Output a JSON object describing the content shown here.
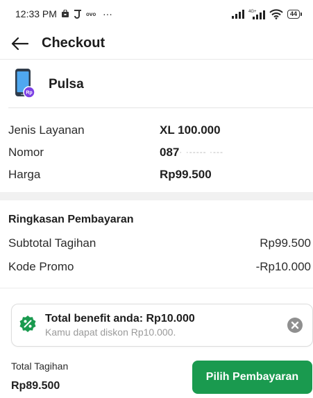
{
  "status_bar": {
    "time": "12:33 PM",
    "network": "4G+",
    "battery": "44",
    "more": "···",
    "icons": [
      "bag-icon",
      "j-icon",
      "ovo-icon",
      "signal-icon",
      "signal-4g-icon",
      "wifi-icon",
      "battery-icon"
    ]
  },
  "header": {
    "title": "Checkout",
    "back_icon": "arrow-left-icon"
  },
  "product": {
    "name": "Pulsa",
    "icon": "phone-rp-icon",
    "badge": "Rp"
  },
  "details": [
    {
      "label": "Jenis Layanan",
      "value": "XL 100.000"
    },
    {
      "label": "Nomor",
      "value": "087"
    },
    {
      "label": "Harga",
      "value": "Rp99.500"
    }
  ],
  "summary": {
    "title": "Ringkasan Pembayaran",
    "rows": [
      {
        "label": "Subtotal Tagihan",
        "value": "Rp99.500"
      },
      {
        "label": "Kode Promo",
        "value": "-Rp10.000"
      }
    ]
  },
  "benefit": {
    "title": "Total benefit anda: Rp10.000",
    "subtitle": "Kamu dapat diskon Rp10.000.",
    "icon": "discount-badge-icon",
    "close_icon": "close-circle-icon"
  },
  "footer": {
    "total_label": "Total Tagihan",
    "total_value": "Rp89.500",
    "pay_label": "Pilih Pembayaran"
  },
  "colors": {
    "primary_green": "#1a9a4f",
    "badge_purple": "#7b3fe4"
  }
}
